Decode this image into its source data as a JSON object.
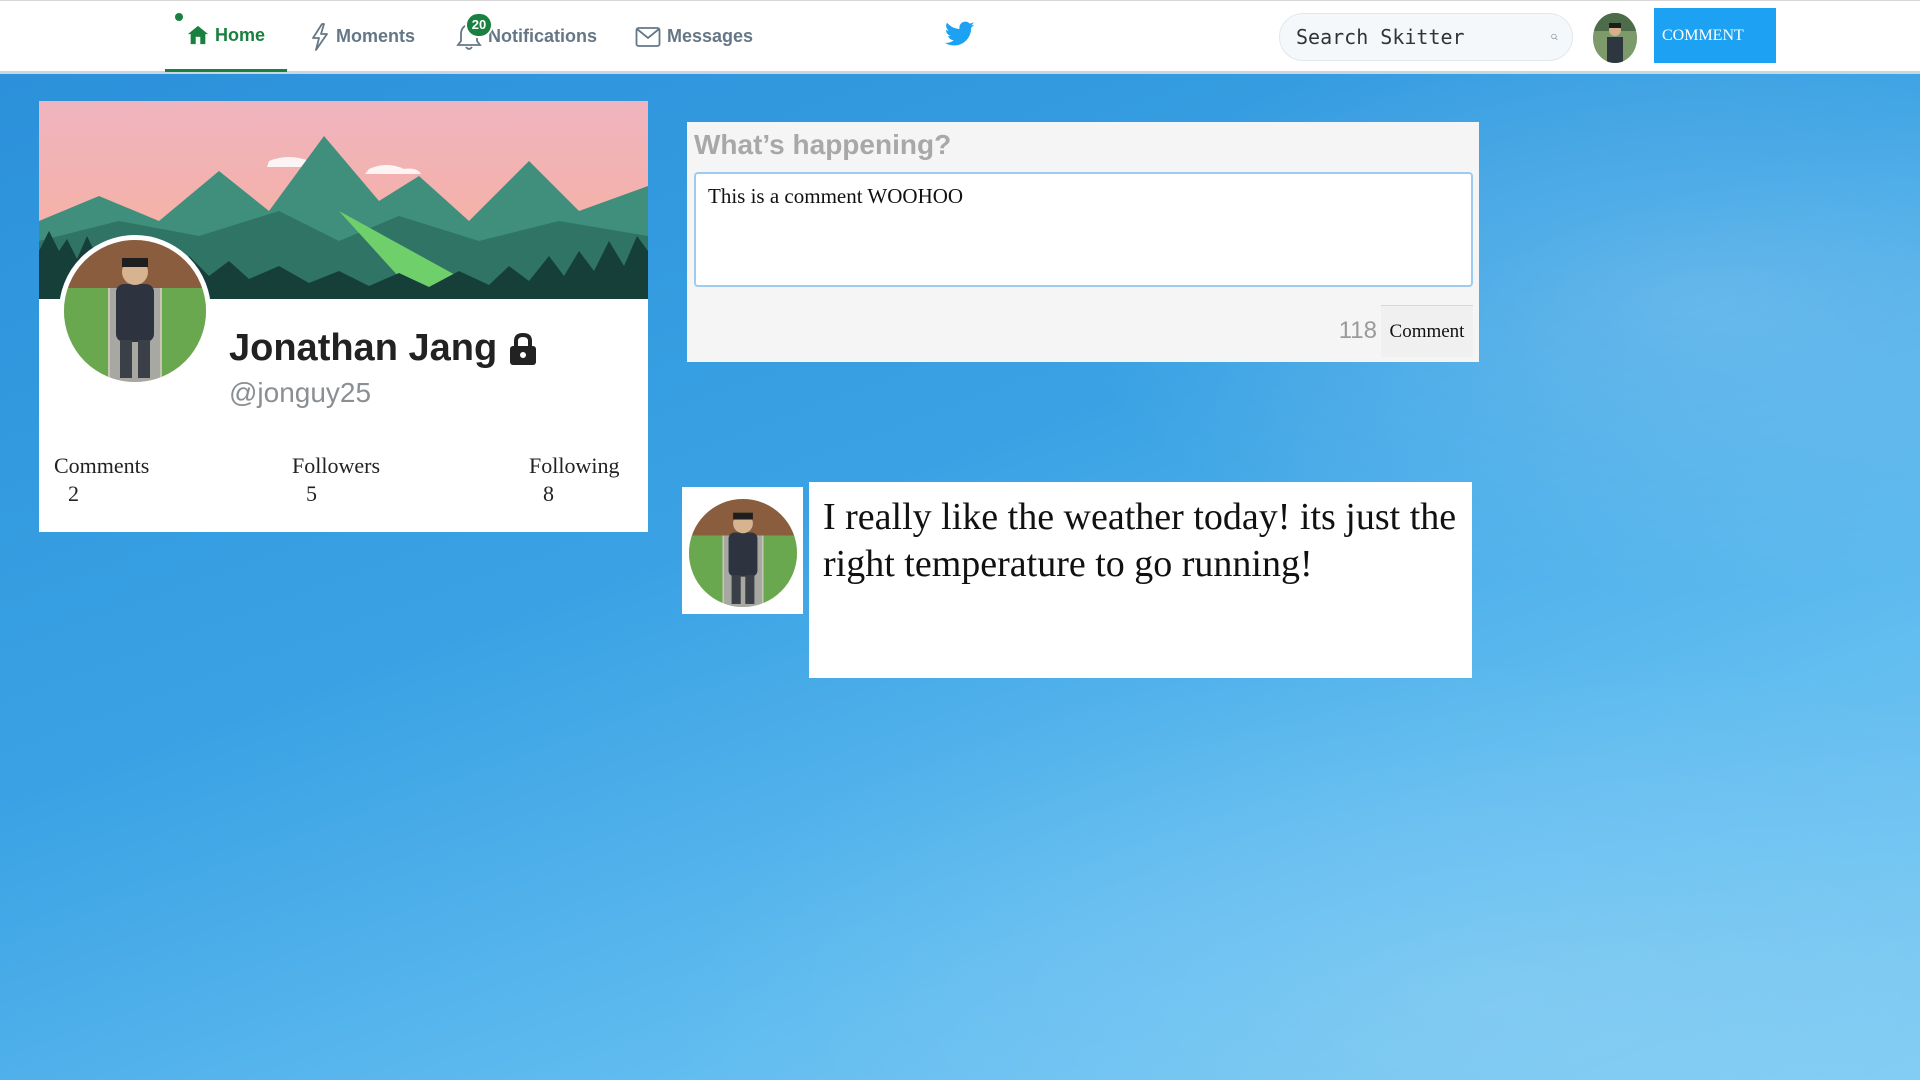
{
  "nav": {
    "home_label": "Home",
    "moments_label": "Moments",
    "notifications_label": "Notifications",
    "notifications_count": "20",
    "messages_label": "Messages",
    "search_placeholder": "Search Skitter",
    "comment_button_label": "COMMENT"
  },
  "profile": {
    "name": "Jonathan Jang",
    "handle": "@jonguy25",
    "stats": [
      {
        "label": "Comments",
        "value": "2"
      },
      {
        "label": "Followers",
        "value": "5"
      },
      {
        "label": "Following",
        "value": "8"
      }
    ]
  },
  "compose": {
    "title": "What’s happening?",
    "value": "This is a comment WOOHOO",
    "chars_remaining": "118",
    "button_label": "Comment"
  },
  "posts": [
    {
      "text": "I really like the weather today! its just the right temperature to go running!"
    }
  ],
  "colors": {
    "accent_green": "#19803f",
    "brand_blue": "#1da1f2",
    "background_blue": "#3aa2e4"
  },
  "icons": [
    "home-icon",
    "lightning-icon",
    "bell-icon",
    "envelope-icon",
    "bird-logo-icon",
    "search-icon",
    "lock-icon"
  ]
}
